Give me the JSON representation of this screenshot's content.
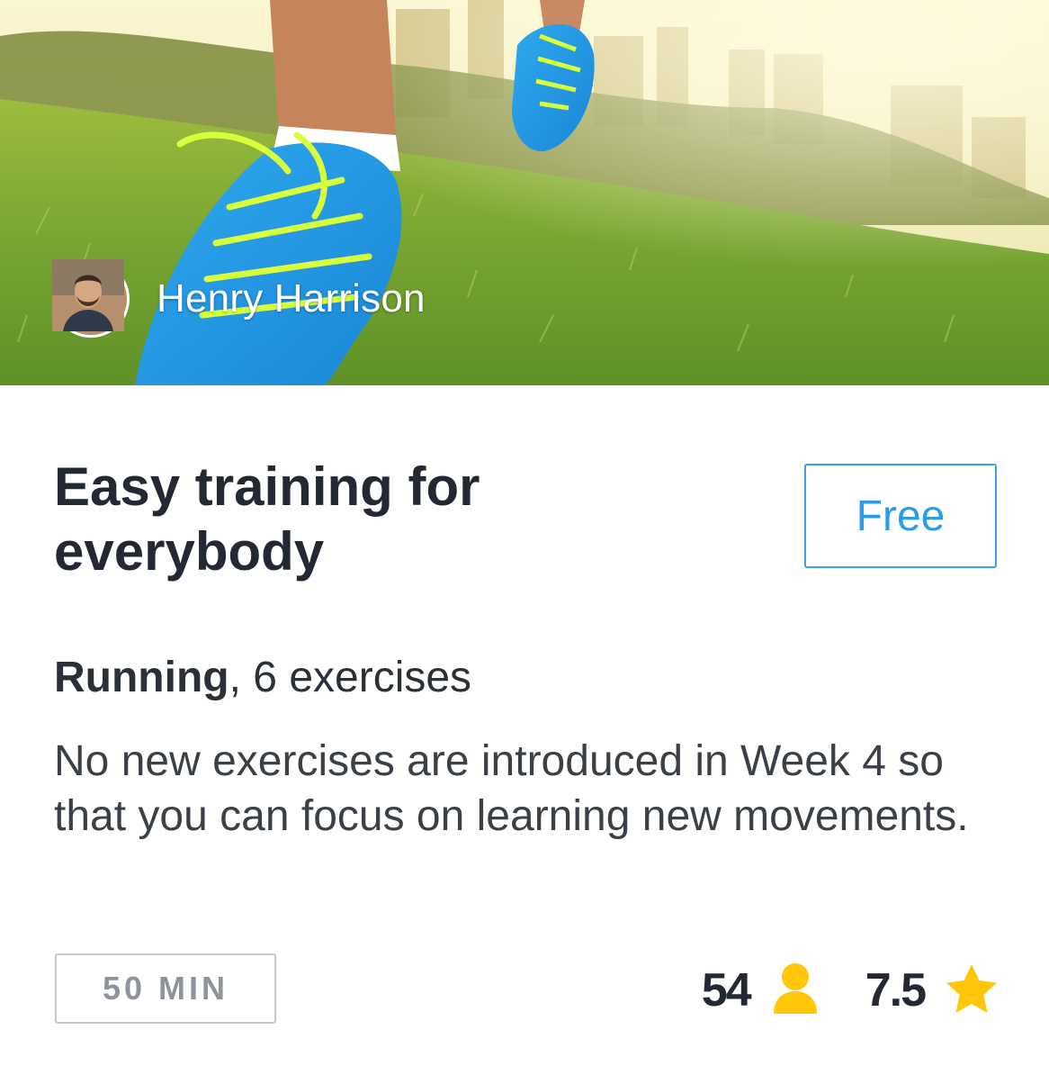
{
  "hero": {
    "author_name": "Henry Harrison",
    "avatar_icon": "author-avatar"
  },
  "course": {
    "title": "Easy training for everybody",
    "price_label": "Free",
    "category": "Running",
    "exercise_count": ", 6 exercises",
    "description": "No new exercises are introduced in Week 4 so that you can focus on learning new movements.",
    "duration": "50 MIN"
  },
  "stats": {
    "participants": "54",
    "participants_icon": "person-icon",
    "rating": "7.5",
    "rating_icon": "star-icon"
  },
  "colors": {
    "accent": "#2b9ce8",
    "icon_yellow": "#ffc60a",
    "title": "#232833",
    "muted": "#8e949c"
  }
}
